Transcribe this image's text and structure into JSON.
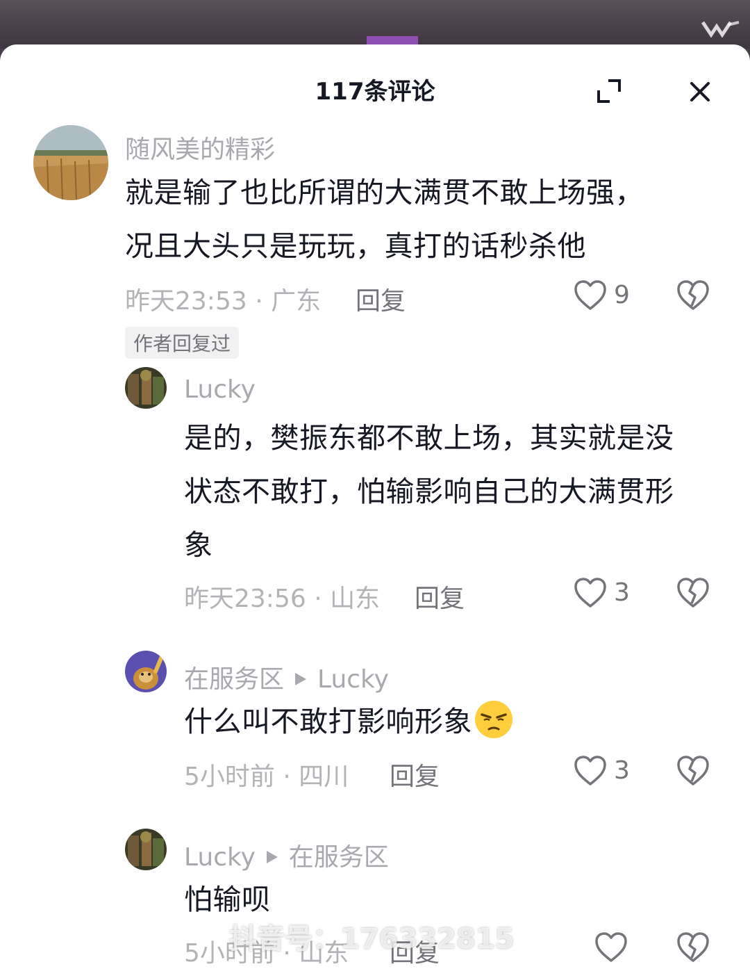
{
  "header": {
    "title": "117条评论"
  },
  "comments": [
    {
      "username": "随风美的精彩",
      "text_lines": [
        "就是输了也比所谓的大满贯不敢上场强，",
        "况且大头只是玩玩，真打的话秒杀他"
      ],
      "meta": "昨天23:53 · 广东",
      "reply_label": "回复",
      "likes": "9",
      "badge": "作者回复过"
    },
    {
      "username": "Lucky",
      "text_lines": [
        "是的，樊振东都不敢上场，其实就是没",
        "状态不敢打，怕输影响自己的大满贯形",
        "象"
      ],
      "meta": "昨天23:56 · 山东",
      "reply_label": "回复",
      "likes": "3"
    },
    {
      "username": "在服务区",
      "reply_to": "Lucky",
      "text": "什么叫不敢打影响形象",
      "meta": "5小时前 · 四川",
      "reply_label": "回复",
      "likes": "3"
    },
    {
      "username": "Lucky",
      "reply_to": "在服务区",
      "text": "怕输呗",
      "meta": "5小时前 · 山东",
      "reply_label": "回复",
      "likes": ""
    }
  ],
  "watermark": "抖音号：176332815",
  "colors": {
    "text_primary": "#161823",
    "text_secondary": "#a8a9ae",
    "background": "#ffffff"
  },
  "icons": [
    "expand-icon",
    "close-icon",
    "heart-icon",
    "broken-heart-icon",
    "squint-emoji-icon"
  ]
}
